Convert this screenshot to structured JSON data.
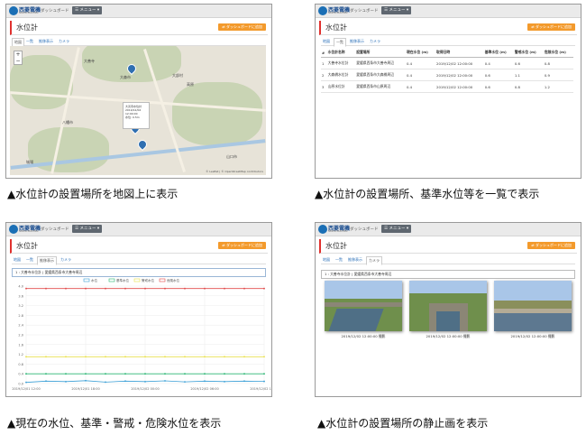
{
  "common": {
    "logo_text": "西菱電機",
    "logo_sub": "SEIRYO ELECTRIC",
    "nav_dashboard": "ダッシュボード",
    "nav_menu": "☰ メニュー ▾",
    "page_title": "水位計",
    "action_button": "⇄ ダッシュボードに追加",
    "tabs": [
      "地図",
      "一覧",
      "推移表示",
      "カメラ"
    ]
  },
  "map": {
    "labels": [
      "大善寺",
      "大森市",
      "八幡市",
      "大部村",
      "高原",
      "城場",
      "山口市"
    ],
    "popup_lines": [
      "大善寺水位計",
      "2019/12/02",
      "12:00:00",
      "水位: 0.5m"
    ],
    "credit": "© Leaflet | © OpenStreetMap contributors",
    "caption": "▲水位計の設置場所を地図上に表示"
  },
  "list": {
    "headers": [
      "#",
      "水位計名称",
      "設置場所",
      "現在水位 (m)",
      "取得日時",
      "基準水位 (m)",
      "警戒水位 (m)",
      "危険水位 (m)"
    ],
    "rows": [
      [
        "1",
        "大善寺水位計",
        "愛媛県西条市大善寺周辺",
        "0.4",
        "2019/12/02 12:00:00",
        "0.4",
        "0.6",
        "0.8"
      ],
      [
        "2",
        "大森橋水位計",
        "愛媛県西条市大森橋周辺",
        "0.4",
        "2019/12/02 12:00:00",
        "0.6",
        "1.1",
        "0.9"
      ],
      [
        "3",
        "山原水位計",
        "愛媛県西条市山原周辺",
        "0.4",
        "2019/12/02 12:00:00",
        "0.6",
        "0.8",
        "1.2"
      ]
    ],
    "caption": "▲水位計の設置場所、基準水位等を一覧で表示"
  },
  "chart": {
    "select_value": "1 : 大善寺水位計 | 愛媛県西条市大善寺周辺",
    "legend": [
      "水位",
      "基準水位",
      "警戒水位",
      "危険水位"
    ],
    "caption": "▲現在の水位、基準・警戒・危険水位を表示"
  },
  "chart_data": {
    "type": "line",
    "x": [
      "2019/12/01 12:00",
      "2019/12/01 18:00",
      "2019/12/02 00:00",
      "2019/12/02 06:00",
      "2019/12/02 12:00"
    ],
    "ylim": [
      0,
      4
    ],
    "y_ticks": [
      "4.0",
      "3.6",
      "3.2",
      "2.8",
      "2.4",
      "2.0",
      "1.6",
      "1.2",
      "0.8",
      "0.4",
      "0.0"
    ],
    "series": [
      {
        "name": "水位",
        "color": "#3a9fd6",
        "values": [
          0.05,
          0.1,
          0.08,
          0.12,
          0.06,
          0.1,
          0.08,
          0.11,
          0.07,
          0.1,
          0.08,
          0.1,
          0.09
        ]
      },
      {
        "name": "基準水位",
        "color": "#2bb673",
        "values": [
          0.4,
          0.4,
          0.4,
          0.4,
          0.4,
          0.4,
          0.4,
          0.4,
          0.4,
          0.4,
          0.4,
          0.4,
          0.4
        ]
      },
      {
        "name": "警戒水位",
        "color": "#e8e04a",
        "values": [
          1.1,
          1.1,
          1.1,
          1.1,
          1.1,
          1.1,
          1.1,
          1.1,
          1.1,
          1.1,
          1.1,
          1.1,
          1.1
        ]
      },
      {
        "name": "危険水位",
        "color": "#e04848",
        "values": [
          3.9,
          3.9,
          3.9,
          3.9,
          3.9,
          3.9,
          3.9,
          3.9,
          3.9,
          3.9,
          3.9,
          3.9,
          3.9
        ]
      }
    ]
  },
  "photos": {
    "select_value": "1 : 大善寺水位計 | 愛媛県西条市大善寺周辺",
    "captions": [
      "2019/12/02 12:00:00 撮影",
      "2019/12/02 12:00:00 撮影",
      "2019/12/02 12:00:00 撮影"
    ],
    "caption": "▲水位計の設置場所の静止画を表示"
  }
}
